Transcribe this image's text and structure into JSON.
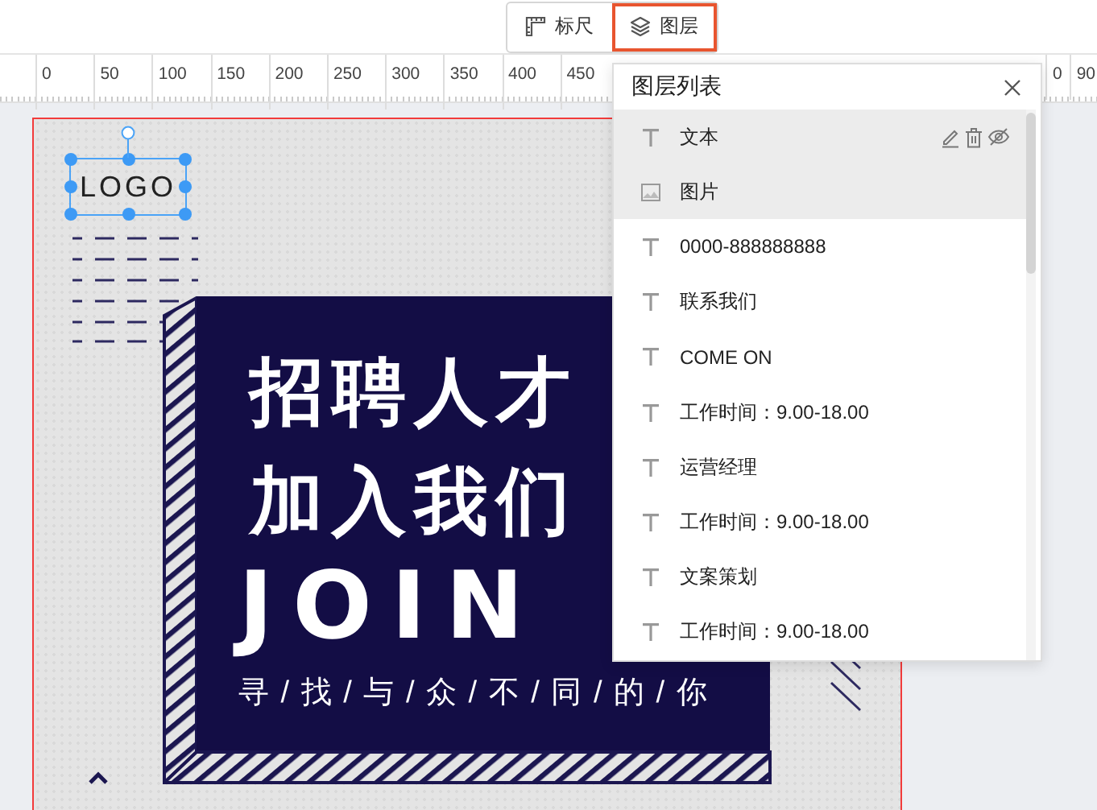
{
  "toolbar": {
    "buttons": [
      {
        "label": "标尺",
        "selected": false
      },
      {
        "label": "图层",
        "selected": true
      }
    ]
  },
  "ruler": {
    "labels": [
      "0",
      "50",
      "100",
      "150",
      "200",
      "250",
      "300",
      "350",
      "400",
      "450"
    ],
    "right_labels": [
      "0",
      "90"
    ]
  },
  "canvas": {
    "logo": {
      "text": "LOGO",
      "selected": true
    },
    "poster": {
      "headline": [
        "招聘人才",
        "加入我们"
      ],
      "english": "JOIN",
      "tagline": "寻 / 找 / 与 / 众 / 不 / 同 / 的 / 你"
    }
  },
  "layer_panel": {
    "title": "图层列表",
    "layers": [
      {
        "kind": "text",
        "name": "文本",
        "hovered": true,
        "selected": true
      },
      {
        "kind": "image",
        "name": "图片",
        "hovered": false,
        "selected": true
      },
      {
        "kind": "text",
        "name": "0000-888888888",
        "hovered": false,
        "selected": false
      },
      {
        "kind": "text",
        "name": "联系我们",
        "hovered": false,
        "selected": false
      },
      {
        "kind": "text",
        "name": "COME ON",
        "hovered": false,
        "selected": false
      },
      {
        "kind": "text",
        "name": "工作时间：9.00-18.00",
        "hovered": false,
        "selected": false
      },
      {
        "kind": "text",
        "name": "运营经理",
        "hovered": false,
        "selected": false
      },
      {
        "kind": "text",
        "name": "工作时间：9.00-18.00",
        "hovered": false,
        "selected": false
      },
      {
        "kind": "text",
        "name": "文案策划",
        "hovered": false,
        "selected": false
      },
      {
        "kind": "text",
        "name": "工作时间：9.00-18.00",
        "hovered": false,
        "selected": false
      }
    ]
  }
}
